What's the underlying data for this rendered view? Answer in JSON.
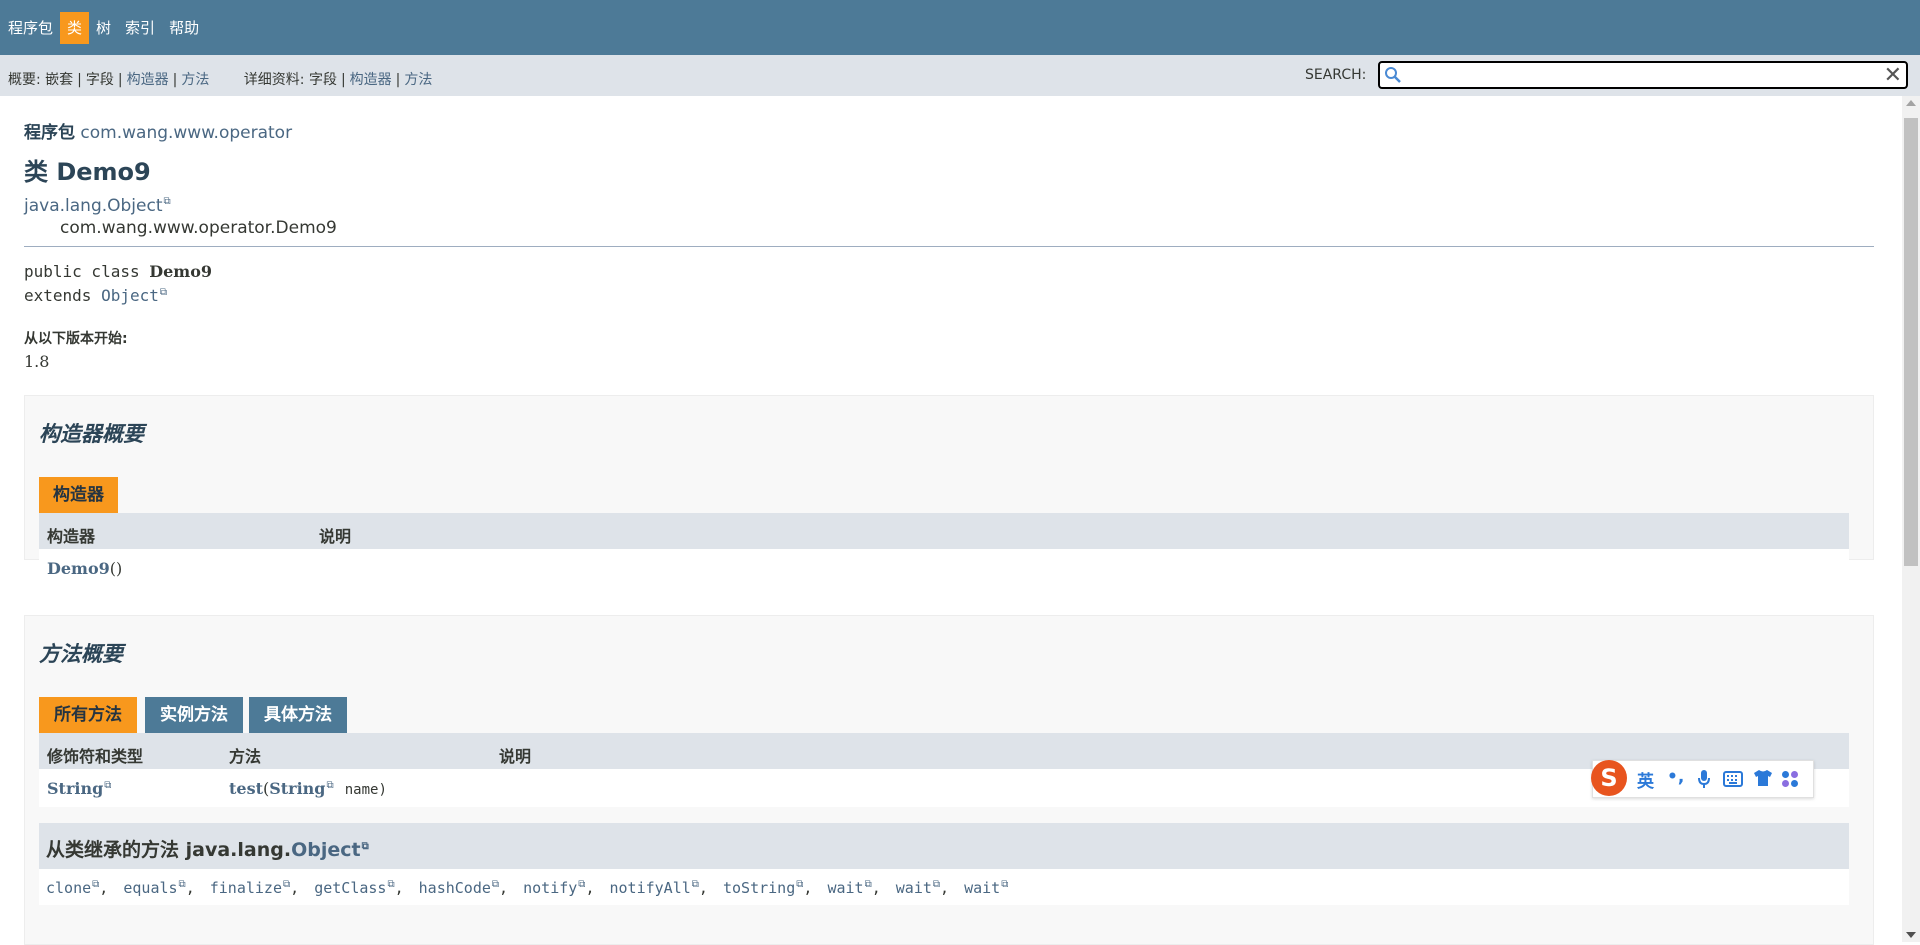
{
  "top_nav": {
    "items": [
      "程序包",
      "类",
      "树",
      "索引",
      "帮助"
    ],
    "active_index": 1
  },
  "sub_nav": {
    "summary_label": "概要:",
    "summary_items": [
      "嵌套",
      "字段",
      "构造器",
      "方法"
    ],
    "detail_label": "详细资料:",
    "detail_items": [
      "字段",
      "构造器",
      "方法"
    ],
    "search_label": "SEARCH:",
    "search_value": ""
  },
  "header": {
    "package_label": "程序包",
    "package_name": "com.wang.www.operator",
    "class_title": "类 Demo9",
    "inheritance_root": "java.lang.Object",
    "inheritance_child": "com.wang.www.operator.Demo9"
  },
  "signature": {
    "decl_prefix": "public class",
    "class_name": "Demo9",
    "extends_kw": "extends",
    "super_name": "Object"
  },
  "since": {
    "label": "从以下版本开始:",
    "value": "1.8"
  },
  "constructor_summary": {
    "title": "构造器概要",
    "tab": "构造器",
    "col_constructor": "构造器",
    "col_desc": "说明",
    "rows": [
      {
        "name": "Demo9",
        "params": "()",
        "desc": ""
      }
    ]
  },
  "method_summary": {
    "title": "方法概要",
    "tabs": [
      "所有方法",
      "实例方法",
      "具体方法"
    ],
    "col_modifier": "修饰符和类型",
    "col_method": "方法",
    "col_desc": "说明",
    "rows": [
      {
        "type": "String",
        "name": "test",
        "open": "(",
        "param_type": "String",
        "param_name": "name)",
        "desc": ""
      }
    ],
    "inherited_label": "从类继承的方法 java.lang.",
    "inherited_class": "Object",
    "inherited_methods": [
      "clone",
      "equals",
      "finalize",
      "getClass",
      "hashCode",
      "notify",
      "notifyAll",
      "toString",
      "wait",
      "wait",
      "wait"
    ]
  },
  "ime_toolbar": {
    "logo": "S",
    "lang": "英",
    "punct": "•,",
    "icons": [
      "microphone-icon",
      "keyboard-icon",
      "skin-icon",
      "apps-icon"
    ]
  },
  "colors": {
    "nav_bg": "#4d7a97",
    "accent": "#f8981d",
    "subnav_bg": "#dee3e9",
    "link": "#4a6782"
  }
}
